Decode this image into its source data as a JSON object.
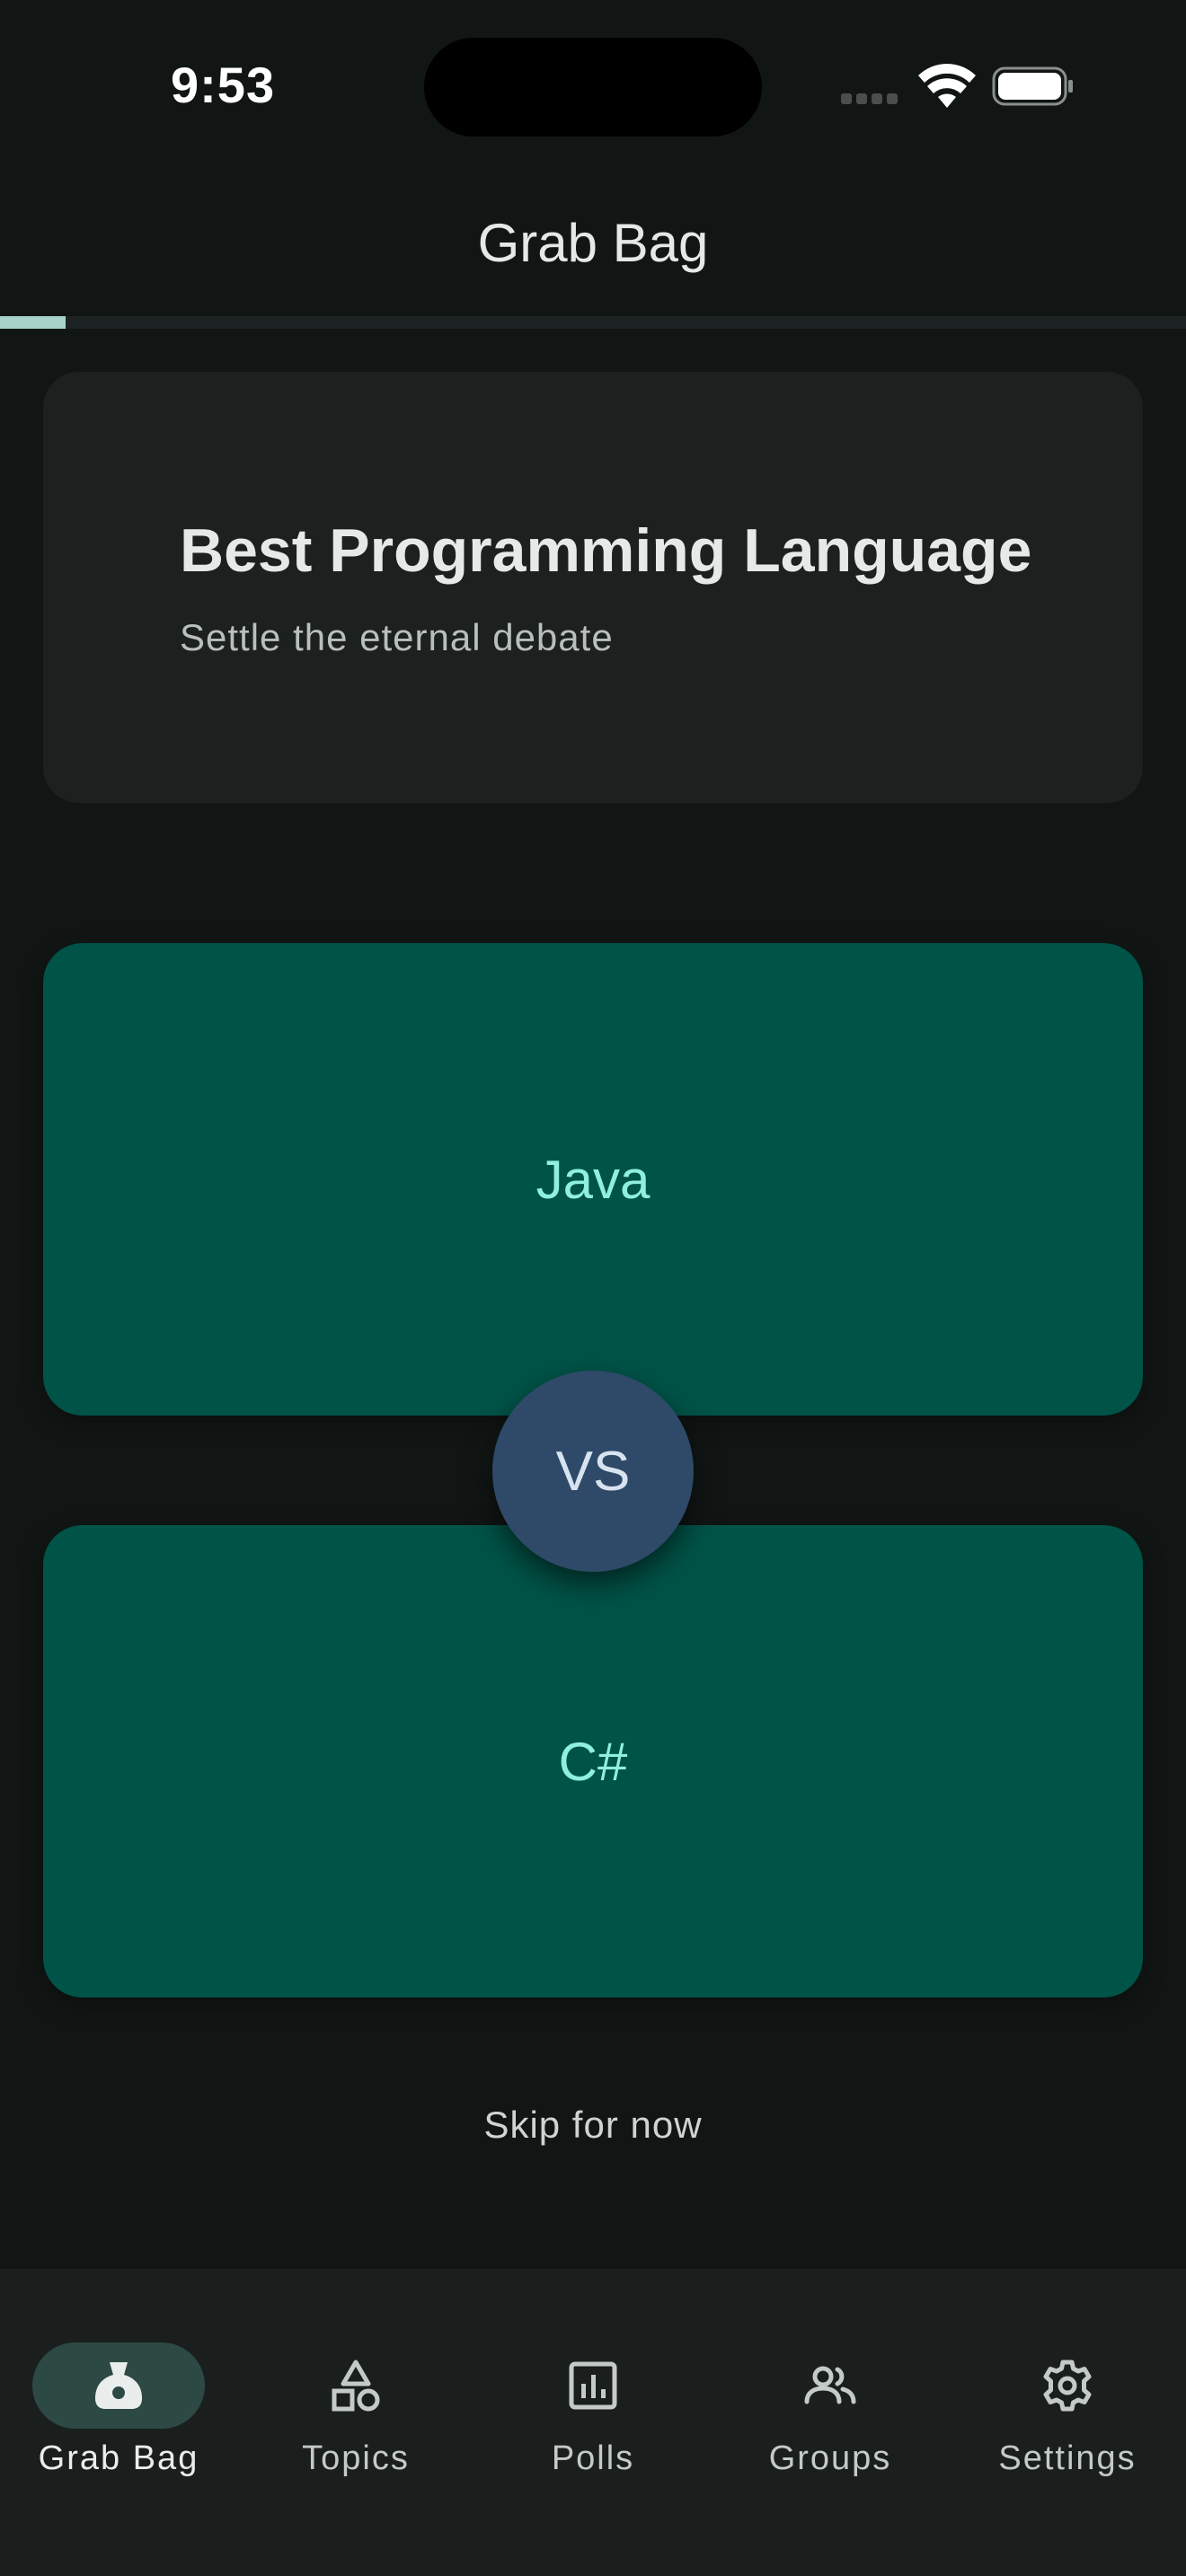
{
  "status": {
    "time": "9:53"
  },
  "app_bar": {
    "title": "Grab Bag"
  },
  "progress": {
    "fraction": 0.055
  },
  "topic": {
    "title": "Best Programming Language",
    "subtitle": "Settle the eternal debate"
  },
  "matchup": {
    "option_a": "Java",
    "vs_label": "VS",
    "option_b": "C#"
  },
  "skip_label": "Skip for now",
  "nav": {
    "items": [
      {
        "label": "Grab Bag",
        "icon": "grab-bag-icon",
        "active": true
      },
      {
        "label": "Topics",
        "icon": "shapes-icon",
        "active": false
      },
      {
        "label": "Polls",
        "icon": "poll-chart-icon",
        "active": false
      },
      {
        "label": "Groups",
        "icon": "groups-icon",
        "active": false
      },
      {
        "label": "Settings",
        "icon": "gear-icon",
        "active": false
      }
    ]
  },
  "colors": {
    "background": "#111615",
    "card": "#1c2120",
    "option": "#005347",
    "option_text": "#8ff0dd",
    "vs_circle": "#2e4a68",
    "nav_active_pill": "#2d4943",
    "progress": "#a7d3cb"
  }
}
